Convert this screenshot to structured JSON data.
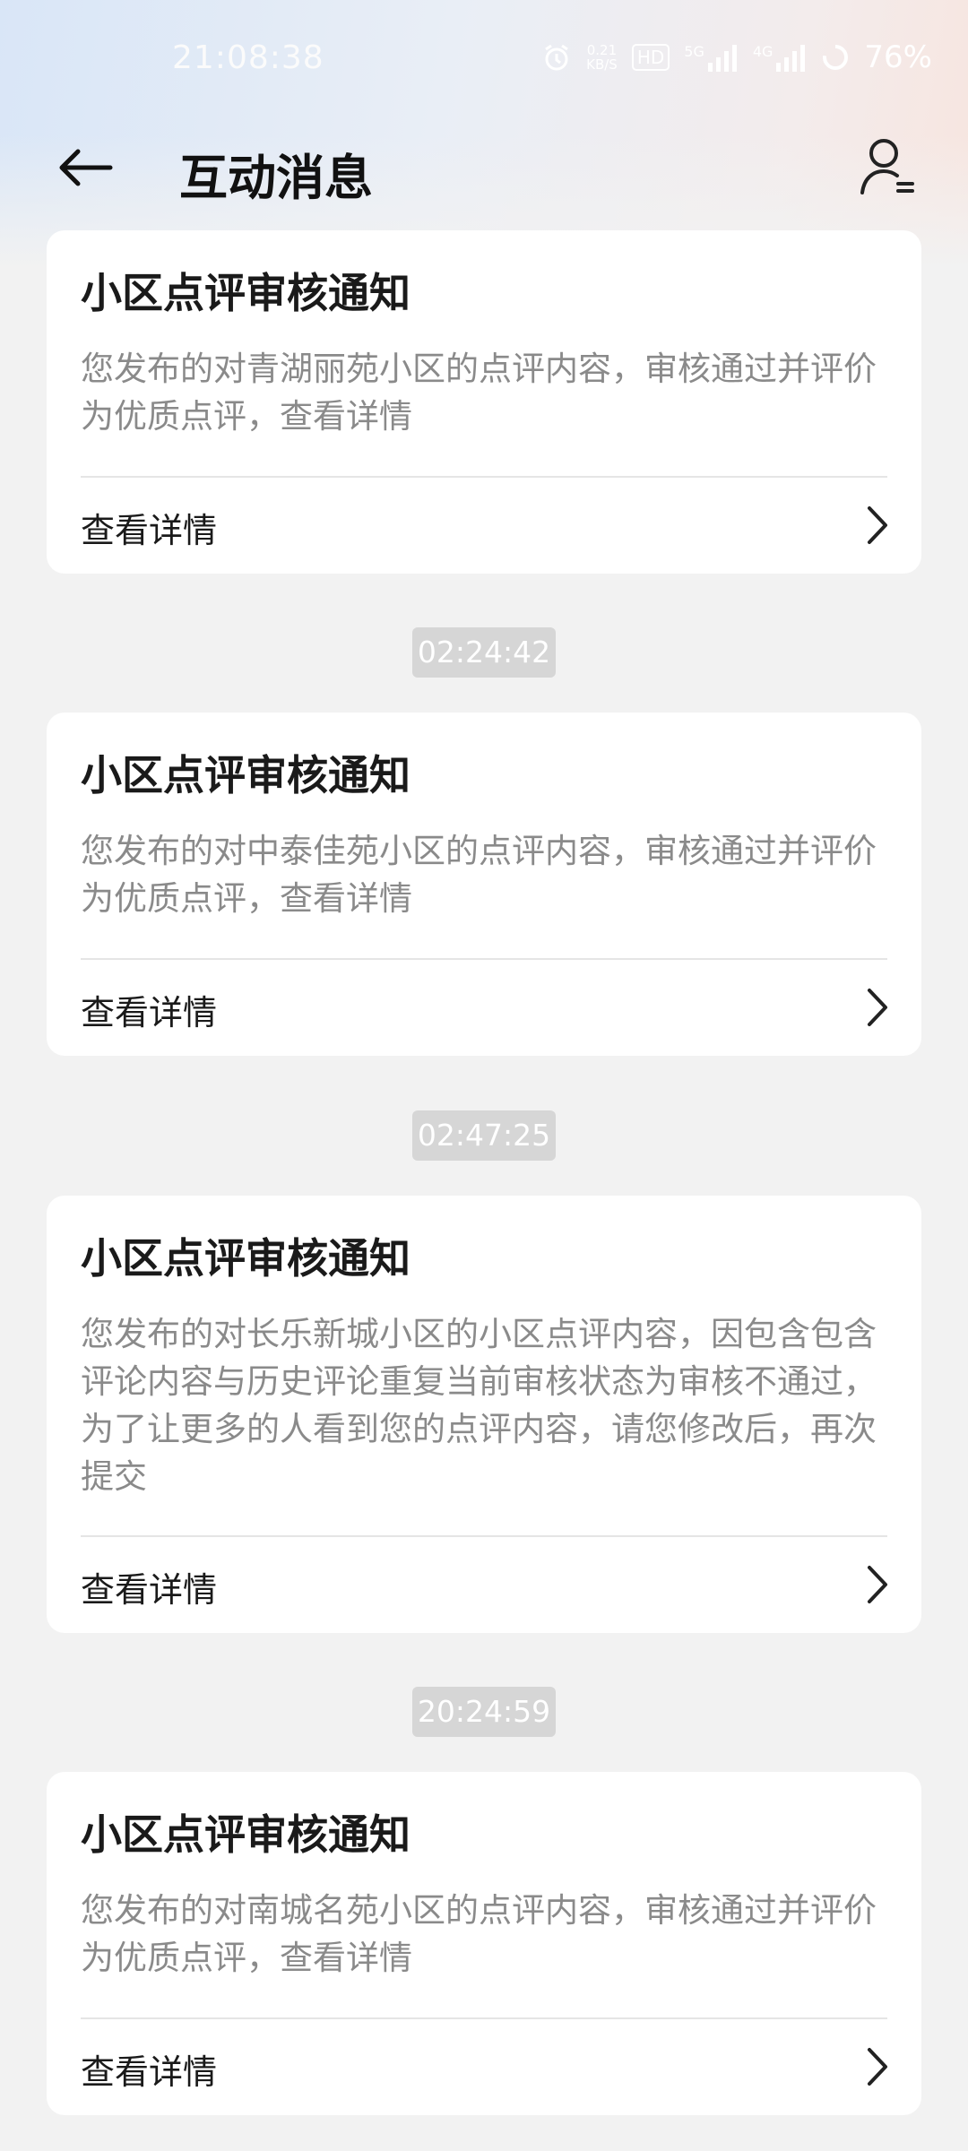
{
  "status_bar": {
    "time": "21:08:38",
    "net_speed_value": "0.21",
    "net_speed_unit": "KB/S",
    "hd_badge": "HD",
    "signal_1": "5G",
    "signal_2": "4G",
    "battery": "76%",
    "icons": [
      "alarm-icon",
      "hd-icon",
      "signal-5g-icon",
      "signal-4g-icon",
      "battery-ring-icon"
    ]
  },
  "header": {
    "title": "互动消息",
    "back_icon": "arrow-left-icon",
    "profile_icon": "user-settings-icon"
  },
  "messages": [
    {
      "title": "小区点评审核通知",
      "body": "您发布的对青湖丽苑小区的点评内容，审核通过并评价为优质点评，查看详情",
      "action": "查看详情"
    },
    {
      "time": "02:24:42",
      "title": "小区点评审核通知",
      "body": "您发布的对中泰佳苑小区的点评内容，审核通过并评价为优质点评，查看详情",
      "action": "查看详情"
    },
    {
      "time": "02:47:25",
      "title": "小区点评审核通知",
      "body": "您发布的对长乐新城小区的小区点评内容，因包含包含评论内容与历史评论重复当前审核状态为审核不通过，为了让更多的人看到您的点评内容，请您修改后，再次提交",
      "action": "查看详情"
    },
    {
      "time": "20:24:59",
      "title": "小区点评审核通知",
      "body": "您发布的对南城名苑小区的点评内容，审核通过并评价为优质点评，查看详情",
      "action": "查看详情"
    }
  ],
  "colors": {
    "background": "#f2f2f2",
    "card": "#ffffff",
    "title_text": "#1a1a1a",
    "body_text": "#8a8a8a",
    "time_badge": "#d6d6d6"
  }
}
